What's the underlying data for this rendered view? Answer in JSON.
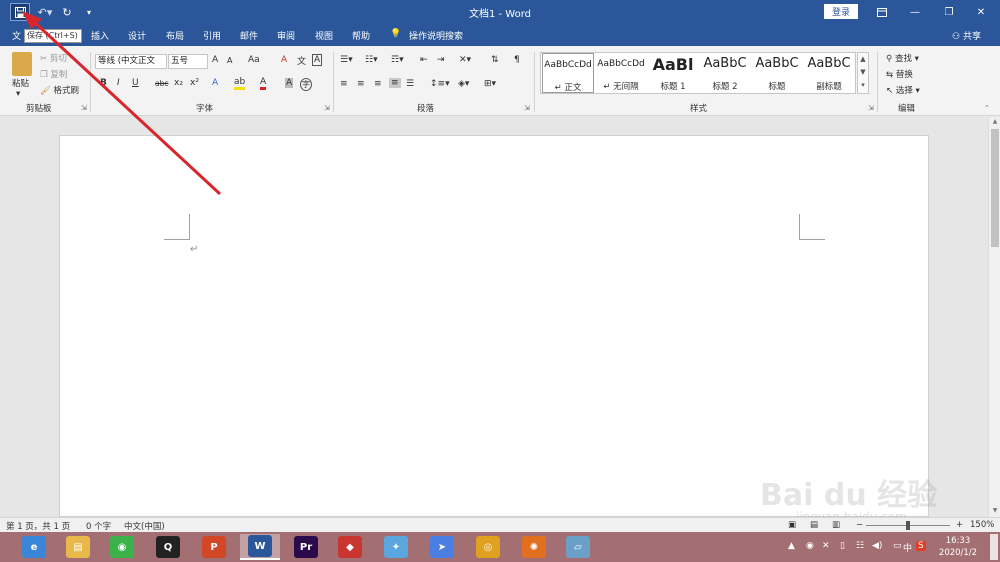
{
  "titlebar": {
    "doc_title": "文档1 - Word",
    "login_label": "登录"
  },
  "tabs": [
    {
      "label": "文"
    },
    {
      "label": "插入"
    },
    {
      "label": "设计"
    },
    {
      "label": "布局"
    },
    {
      "label": "引用"
    },
    {
      "label": "邮件"
    },
    {
      "label": "审阅"
    },
    {
      "label": "视图"
    },
    {
      "label": "帮助"
    },
    {
      "label": "操作说明搜索"
    }
  ],
  "tooltip": "保存 (Ctrl+S)",
  "share_label": "共享",
  "ribbon": {
    "clipboard": {
      "paste": "粘贴",
      "cut": "剪切",
      "copy": "复制",
      "format_painter": "格式刷",
      "group": "剪贴板"
    },
    "font": {
      "font_name": "等线 (中文正文",
      "font_size": "五号",
      "grow": "A",
      "shrink": "A",
      "case": "Aa",
      "clear": "A",
      "phonetic": "文",
      "border": "A",
      "bold": "B",
      "italic": "I",
      "underline": "U",
      "strike": "abc",
      "subscript": "x₂",
      "superscript": "x²",
      "text_effect": "A",
      "highlight": "ab",
      "font_color": "A",
      "char_shade": "A",
      "enclose": "字",
      "group": "字体"
    },
    "paragraph": {
      "group": "段落"
    },
    "styles": {
      "items": [
        {
          "preview": "AaBbCcDd",
          "name": "正文"
        },
        {
          "preview": "AaBbCcDd",
          "name": "无间隔"
        },
        {
          "preview": "AaBl",
          "name": "标题 1"
        },
        {
          "preview": "AaBbC",
          "name": "标题 2"
        },
        {
          "preview": "AaBbC",
          "name": "标题"
        },
        {
          "preview": "AaBbC",
          "name": "副标题"
        }
      ],
      "group": "样式"
    },
    "editing": {
      "find": "查找",
      "replace": "替换",
      "select": "选择",
      "group": "编辑"
    }
  },
  "status": {
    "page": "第 1 页，共 1 页",
    "words": "0 个字",
    "language": "中文(中国)",
    "zoom": "150%",
    "minus": "−",
    "plus": "+"
  },
  "taskbar": {
    "apps": [
      {
        "name": "browser-360",
        "color": "#3a86d8",
        "glyph": "e"
      },
      {
        "name": "file-explorer",
        "color": "#e8b84a",
        "glyph": "▤"
      },
      {
        "name": "wechat",
        "color": "#3bb34a",
        "glyph": "◉"
      },
      {
        "name": "qq",
        "color": "#222222",
        "glyph": "Q"
      },
      {
        "name": "powerpoint",
        "color": "#d24726",
        "glyph": "P"
      },
      {
        "name": "word",
        "color": "#2b579a",
        "glyph": "W"
      },
      {
        "name": "premiere",
        "color": "#2a0a4a",
        "glyph": "Pr"
      },
      {
        "name": "app-red",
        "color": "#c8362f",
        "glyph": "◆"
      },
      {
        "name": "app-bird",
        "color": "#5aa7e0",
        "glyph": "✦"
      },
      {
        "name": "app-send",
        "color": "#4a7ee0",
        "glyph": "➤"
      },
      {
        "name": "chrome",
        "color": "#e0a020",
        "glyph": "◎"
      },
      {
        "name": "app-orange",
        "color": "#e07020",
        "glyph": "✺"
      },
      {
        "name": "app-glass",
        "color": "#6aa0c8",
        "glyph": "▱"
      }
    ],
    "time": "16:33",
    "date": "2020/1/2",
    "ime": "中"
  },
  "watermark": {
    "text": "Bai du 经验",
    "url": "jingyan.baidu.com"
  },
  "colors": {
    "word_blue": "#2b579a",
    "annotation_red": "#d9262c",
    "taskbar": "#a46f73"
  }
}
